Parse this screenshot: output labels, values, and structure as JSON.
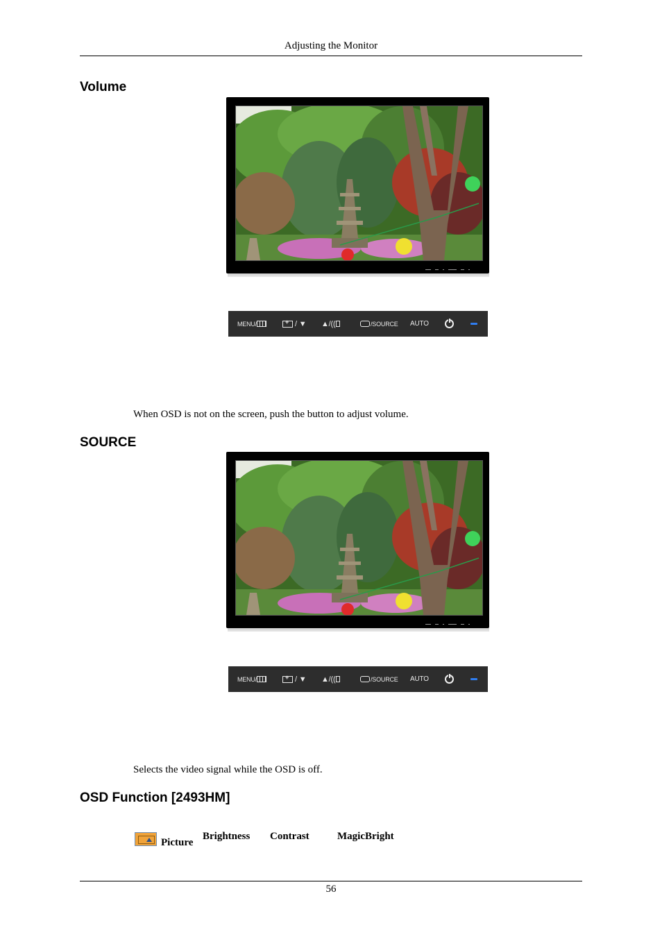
{
  "header": {
    "title": "Adjusting the Monitor"
  },
  "sections": [
    {
      "heading": "Volume",
      "description": "When OSD is not on the screen, push the button to adjust volume."
    },
    {
      "heading": "SOURCE",
      "description": "Selects the video signal while the OSD is off."
    },
    {
      "heading": "OSD Function [2493HM]"
    }
  ],
  "button_bar": {
    "menu_label": "MENU/",
    "brightness_label": "/ ▼",
    "volume_label": "▲/((",
    "source_label": "/SOURCE",
    "auto_label": "AUTO",
    "power_icon": "power-icon",
    "power_led_color": "#2f7df0"
  },
  "osd_menu": {
    "icon": "picture-icon",
    "category": "Picture",
    "items": [
      "Brightness",
      "Contrast",
      "MagicBright"
    ]
  },
  "footer": {
    "page_number": "56"
  }
}
